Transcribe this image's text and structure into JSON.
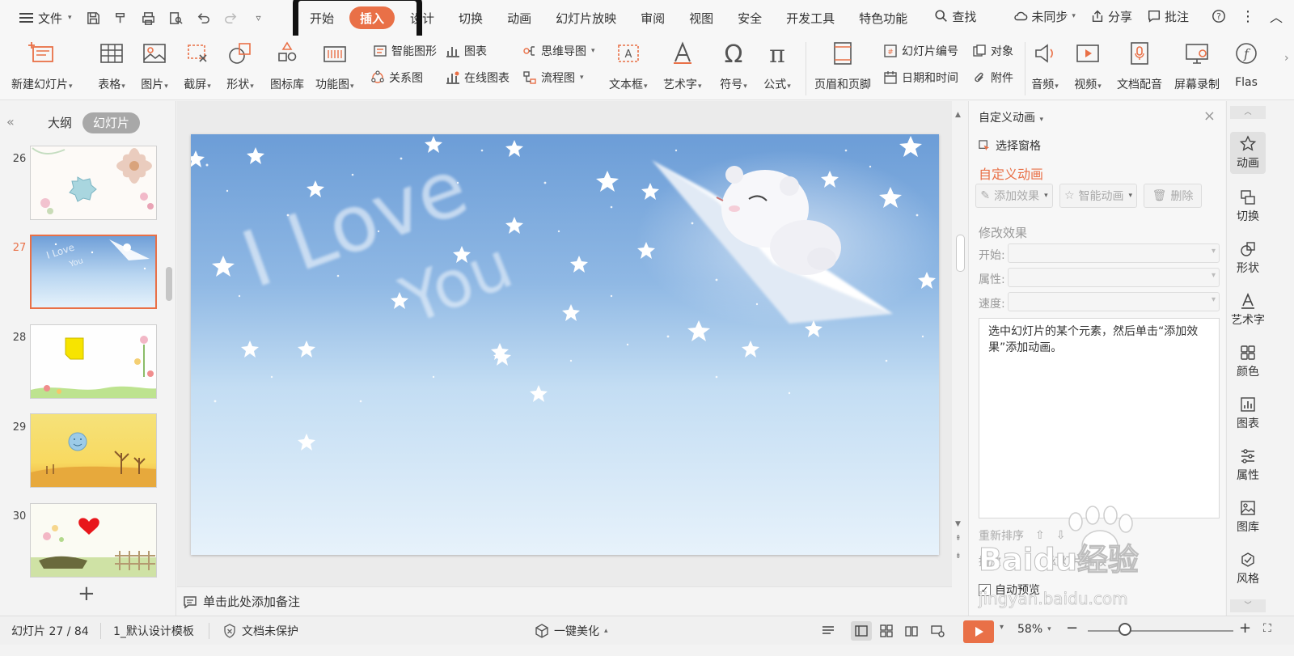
{
  "app": {
    "menu_label": "文件",
    "tabs": [
      "开始",
      "插入",
      "设计",
      "切换",
      "动画",
      "幻灯片放映",
      "审阅",
      "视图",
      "安全",
      "开发工具",
      "特色功能"
    ],
    "active_tab": "插入",
    "search_label": "查找",
    "sync_label": "未同步",
    "share_label": "分享",
    "annotate_label": "批注"
  },
  "ribbon": {
    "new_slide": "新建幻灯片",
    "table": "表格",
    "picture": "图片",
    "screenshot": "截屏",
    "shape": "形状",
    "icon_lib": "图标库",
    "func_chart": "功能图",
    "smart_shape": "智能图形",
    "chart": "图表",
    "relation": "关系图",
    "online_chart": "在线图表",
    "mindmap": "思维导图",
    "flowchart": "流程图",
    "textbox": "文本框",
    "wordart": "艺术字",
    "symbol": "符号",
    "formula": "公式",
    "header_footer": "页眉和页脚",
    "slide_number": "幻灯片编号",
    "object": "对象",
    "datetime": "日期和时间",
    "attachment": "附件",
    "audio": "音频",
    "video": "视频",
    "doc_dub": "文档配音",
    "screen_record": "屏幕录制",
    "flash": "Flas"
  },
  "slide_panel": {
    "tab_outline": "大纲",
    "tab_slides": "幻灯片",
    "thumbnails": [
      {
        "number": "26"
      },
      {
        "number": "27",
        "selected": true
      },
      {
        "number": "28"
      },
      {
        "number": "29"
      },
      {
        "number": "30"
      }
    ]
  },
  "slide": {
    "text_line1": "I Love",
    "text_line2": "You"
  },
  "notes_placeholder": "单击此处添加备注",
  "task_pane": {
    "title": "自定义动画",
    "select_pane": "选择窗格",
    "heading": "自定义动画",
    "add_effect": "添加效果",
    "smart_anim": "智能动画",
    "delete": "删除",
    "modify_effect": "修改效果",
    "start_label": "开始:",
    "property_label": "属性:",
    "speed_label": "速度:",
    "message": "选中幻灯片的某个元素，然后单击“添加效果”添加动画。",
    "reorder": "重新排序",
    "play": "播放",
    "slide_show": "幻灯片播放",
    "auto_preview": "自动预览"
  },
  "watermark": {
    "brand": "Baidu经验",
    "url": "jingyan.baidu.com"
  },
  "sidebar": [
    "动画",
    "切换",
    "形状",
    "艺术字",
    "颜色",
    "图表",
    "属性",
    "图库",
    "风格"
  ],
  "status": {
    "slide_counter": "幻灯片 27 / 84",
    "template": "1_默认设计模板",
    "protection": "文档未保护",
    "beautify": "一键美化",
    "zoom": "58%"
  },
  "colors": {
    "accent": "#e97047",
    "sky_top": "#6f9fd8",
    "sky_bottom": "#e4f1fb"
  }
}
